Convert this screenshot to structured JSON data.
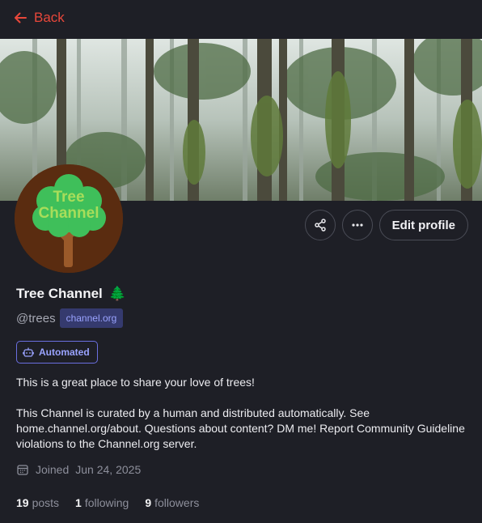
{
  "nav": {
    "back_label": "Back"
  },
  "avatar": {
    "line1": "Tree",
    "line2": "Channel"
  },
  "actions": {
    "edit_label": "Edit profile"
  },
  "profile": {
    "display_name": "Tree Channel",
    "emoji": "🌲",
    "handle": "@trees",
    "domain": "channel.org",
    "automated_label": "Automated",
    "bio_paragraph_1": "This is a great place to share your love of trees!",
    "bio_paragraph_2": "This Channel is curated by a human and distributed automatically. See home.channel.org/about. Questions about content? DM me! Report Community Guideline violations to the Channel.org server.",
    "joined_label": "Joined",
    "joined_date": "Jun 24, 2025"
  },
  "stats": {
    "posts_count": "19",
    "posts_label": "posts",
    "following_count": "1",
    "following_label": "following",
    "followers_count": "9",
    "followers_label": "followers"
  },
  "colors": {
    "background": "#1e1f26",
    "accent_red": "#e8473a",
    "badge_blue": "#9aa3ff",
    "avatar_bg": "#5a2c10",
    "tree_green": "#3fbf5a"
  },
  "icons": [
    "arrow-left-icon",
    "share-icon",
    "more-icon",
    "robot-icon",
    "calendar-icon",
    "tree-emoji"
  ]
}
